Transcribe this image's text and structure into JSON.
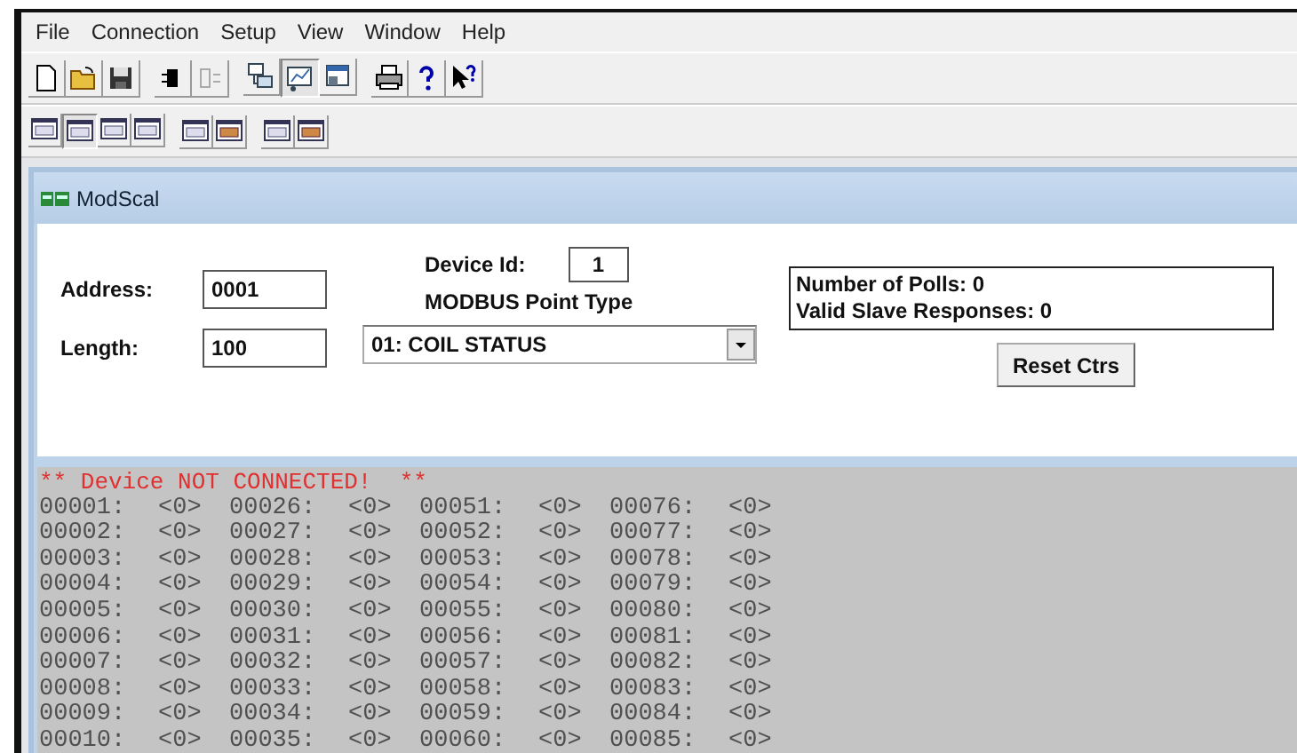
{
  "menu": [
    {
      "label": "File"
    },
    {
      "label": "Connection"
    },
    {
      "label": "Setup"
    },
    {
      "label": "View"
    },
    {
      "label": "Window"
    },
    {
      "label": "Help"
    }
  ],
  "toolbars": [
    {
      "groups": [
        [
          {
            "kind": "new",
            "pressed": false,
            "disabled": false
          },
          {
            "kind": "open",
            "pressed": false,
            "disabled": false
          },
          {
            "kind": "save",
            "pressed": false,
            "disabled": false
          }
        ],
        [
          {
            "kind": "connect",
            "pressed": false,
            "disabled": false
          },
          {
            "kind": "disconnect",
            "pressed": false,
            "disabled": true
          }
        ],
        [
          {
            "kind": "tree",
            "pressed": false,
            "disabled": false
          },
          {
            "kind": "chart",
            "pressed": true,
            "disabled": false
          },
          {
            "kind": "window",
            "pressed": false,
            "disabled": false
          }
        ],
        [
          {
            "kind": "print",
            "pressed": false,
            "disabled": false
          },
          {
            "kind": "help",
            "pressed": false,
            "disabled": false
          },
          {
            "kind": "context-help",
            "pressed": false,
            "disabled": false
          }
        ]
      ]
    },
    {
      "groups": [
        [
          {
            "kind": "format",
            "pressed": false,
            "disabled": false
          },
          {
            "kind": "format",
            "pressed": true,
            "disabled": false
          },
          {
            "kind": "format",
            "pressed": false,
            "disabled": false
          },
          {
            "kind": "format",
            "pressed": false,
            "disabled": false
          }
        ],
        [
          {
            "kind": "format",
            "pressed": false,
            "disabled": false
          },
          {
            "kind": "format-alt",
            "pressed": false,
            "disabled": false
          }
        ],
        [
          {
            "kind": "format",
            "pressed": false,
            "disabled": false
          },
          {
            "kind": "format-alt",
            "pressed": false,
            "disabled": false
          }
        ]
      ]
    }
  ],
  "child_window": {
    "title": "ModScal"
  },
  "form": {
    "address": {
      "label": "Address:",
      "value": "0001"
    },
    "length": {
      "label": "Length:",
      "value": "100"
    },
    "device_id": {
      "label": "Device Id:",
      "value": "1"
    },
    "point_type": {
      "label": "MODBUS Point Type",
      "value": "01: COIL STATUS"
    },
    "stats": [
      "Number of Polls: 0",
      "Valid Slave Responses: 0"
    ],
    "reset_button": "Reset Ctrs"
  },
  "data": {
    "status": "** Device NOT CONNECTED!  **",
    "rows": [
      [
        {
          "address": "00001:",
          "value": "<0>"
        },
        {
          "address": "00026:",
          "value": "<0>"
        },
        {
          "address": "00051:",
          "value": "<0>"
        },
        {
          "address": "00076:",
          "value": "<0>"
        }
      ],
      [
        {
          "address": "00002:",
          "value": "<0>"
        },
        {
          "address": "00027:",
          "value": "<0>"
        },
        {
          "address": "00052:",
          "value": "<0>"
        },
        {
          "address": "00077:",
          "value": "<0>"
        }
      ],
      [
        {
          "address": "00003:",
          "value": "<0>"
        },
        {
          "address": "00028:",
          "value": "<0>"
        },
        {
          "address": "00053:",
          "value": "<0>"
        },
        {
          "address": "00078:",
          "value": "<0>"
        }
      ],
      [
        {
          "address": "00004:",
          "value": "<0>"
        },
        {
          "address": "00029:",
          "value": "<0>"
        },
        {
          "address": "00054:",
          "value": "<0>"
        },
        {
          "address": "00079:",
          "value": "<0>"
        }
      ],
      [
        {
          "address": "00005:",
          "value": "<0>"
        },
        {
          "address": "00030:",
          "value": "<0>"
        },
        {
          "address": "00055:",
          "value": "<0>"
        },
        {
          "address": "00080:",
          "value": "<0>"
        }
      ],
      [
        {
          "address": "00006:",
          "value": "<0>"
        },
        {
          "address": "00031:",
          "value": "<0>"
        },
        {
          "address": "00056:",
          "value": "<0>"
        },
        {
          "address": "00081:",
          "value": "<0>"
        }
      ],
      [
        {
          "address": "00007:",
          "value": "<0>"
        },
        {
          "address": "00032:",
          "value": "<0>"
        },
        {
          "address": "00057:",
          "value": "<0>"
        },
        {
          "address": "00082:",
          "value": "<0>"
        }
      ],
      [
        {
          "address": "00008:",
          "value": "<0>"
        },
        {
          "address": "00033:",
          "value": "<0>"
        },
        {
          "address": "00058:",
          "value": "<0>"
        },
        {
          "address": "00083:",
          "value": "<0>"
        }
      ],
      [
        {
          "address": "00009:",
          "value": "<0>"
        },
        {
          "address": "00034:",
          "value": "<0>"
        },
        {
          "address": "00059:",
          "value": "<0>"
        },
        {
          "address": "00084:",
          "value": "<0>"
        }
      ],
      [
        {
          "address": "00010:",
          "value": "<0>"
        },
        {
          "address": "00035:",
          "value": "<0>"
        },
        {
          "address": "00060:",
          "value": "<0>"
        },
        {
          "address": "00085:",
          "value": "<0>"
        }
      ]
    ]
  }
}
